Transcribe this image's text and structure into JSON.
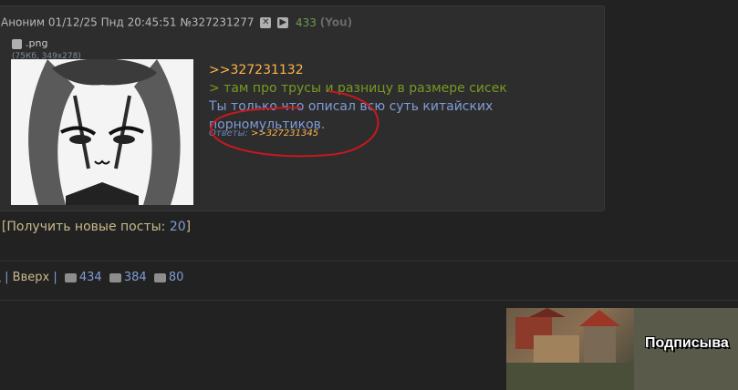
{
  "post": {
    "author": "Аноним",
    "datetime": "01/12/25 Пнд 20:45:51",
    "number": "№327231277",
    "reply_count": "433",
    "you_label": "(You)",
    "file_name": ".png",
    "file_meta": "(75Кб, 349x278)",
    "reply_link": ">>327231132",
    "quote_line": "> там про трусы и разницу в размере сисек",
    "message": "Ты только что описал всю суть китайских порномультиков.",
    "answers_label": "Ответы:",
    "answers_link": ">>327231345"
  },
  "new_posts": {
    "bracket": "]",
    "label": "[Получить новые посты:",
    "count": "20",
    "close": "]"
  },
  "bottom_bar": {
    "prefix": "д",
    "up_label": "Вверх",
    "posts": "434",
    "images": "384",
    "posters": "80"
  },
  "banner": {
    "text": "Подписыва"
  },
  "colors": {
    "background": "#222222",
    "post_bg": "#2d2d2d",
    "reply_link": "#ffb44a",
    "quote": "#789922",
    "message": "#7f9cd6",
    "annotation": "#c8181e"
  }
}
